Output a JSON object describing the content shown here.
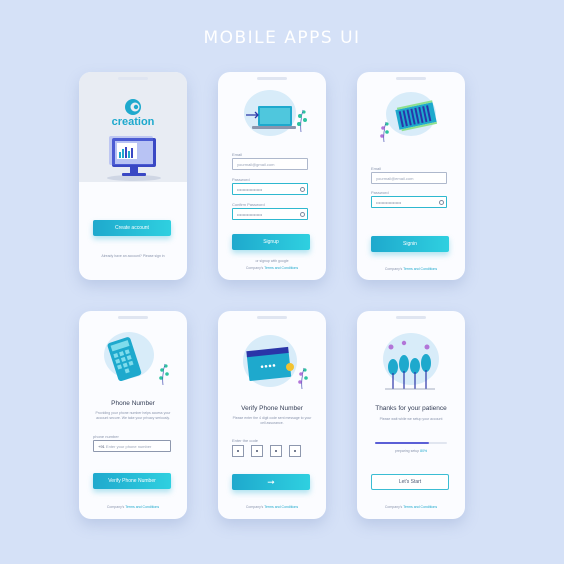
{
  "page_title": "MOBILE APPS UI",
  "colors": {
    "background": "#d5e1f7",
    "accent": "#1ea9cd",
    "accent_light": "#2fd0e0",
    "accent_purple": "#5b5fd6"
  },
  "screen1": {
    "brand_name": "creation",
    "create_account_label": "Create account",
    "footer_text": "Already have an account? Please sign in"
  },
  "screen2": {
    "email_label": "Email",
    "email_value": "yourmail@gmail.com",
    "password_label": "Password",
    "password_value": "••••••••••••••••••",
    "confirm_label": "Confirm Password",
    "confirm_value": "••••••••••••••••••",
    "signup_label": "Signup",
    "alt_text": "or signup with google",
    "terms_prefix": "Company's",
    "terms_link": "Terms and Conditions"
  },
  "screen3": {
    "email_label": "Email",
    "email_value": "yourmail@email.com",
    "password_label": "Password",
    "password_value": "••••••••••••••••••",
    "signin_label": "Signin",
    "terms_prefix": "Company's",
    "terms_link": "Terms and Conditions"
  },
  "screen4": {
    "heading": "Phone Number",
    "description": "Providing your phone number helps access your account secure. We take your privacy seriously.",
    "field_label": "phone number",
    "country_code": "+91",
    "placeholder": "Enter your phone number",
    "button_label": "Verify Phone Number",
    "terms_prefix": "Company's",
    "terms_link": "Terms and Conditions"
  },
  "screen5": {
    "heading": "Verify Phone Number",
    "description": "Please enter the 4 digit code sent message to your cell assurance.",
    "field_label": "Enter the code",
    "arrow": "➞",
    "terms_prefix": "Company's",
    "terms_link": "Terms and Conditions"
  },
  "screen6": {
    "heading": "Thanks for your patience",
    "description": "Please wait while we setup your account",
    "progress": 0.75,
    "progress_text_prefix": "preparing setup",
    "progress_text_value": "80%",
    "button_label": "Let's Start",
    "terms_prefix": "Company's",
    "terms_link": "Terms and Conditions"
  }
}
